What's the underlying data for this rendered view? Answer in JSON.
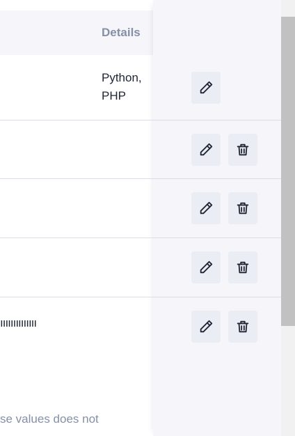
{
  "table": {
    "header": {
      "details": "Details"
    },
    "rows": [
      {
        "details": "Python, PHP",
        "actions": [
          "edit"
        ]
      },
      {
        "details": "",
        "actions": [
          "edit",
          "delete"
        ]
      },
      {
        "details": "",
        "actions": [
          "edit",
          "delete"
        ]
      },
      {
        "details": "",
        "actions": [
          "edit",
          "delete"
        ]
      },
      {
        "details": "",
        "text": "ıııııııııııııı",
        "actions": [
          "edit",
          "delete"
        ]
      }
    ],
    "footer_note": "se values does not"
  },
  "icons": {
    "edit": "pencil-icon",
    "delete": "trash-icon"
  },
  "colors": {
    "header_bg": "#f5f5fa",
    "button_bg": "#ebedf5",
    "muted_text": "#8590a8"
  }
}
